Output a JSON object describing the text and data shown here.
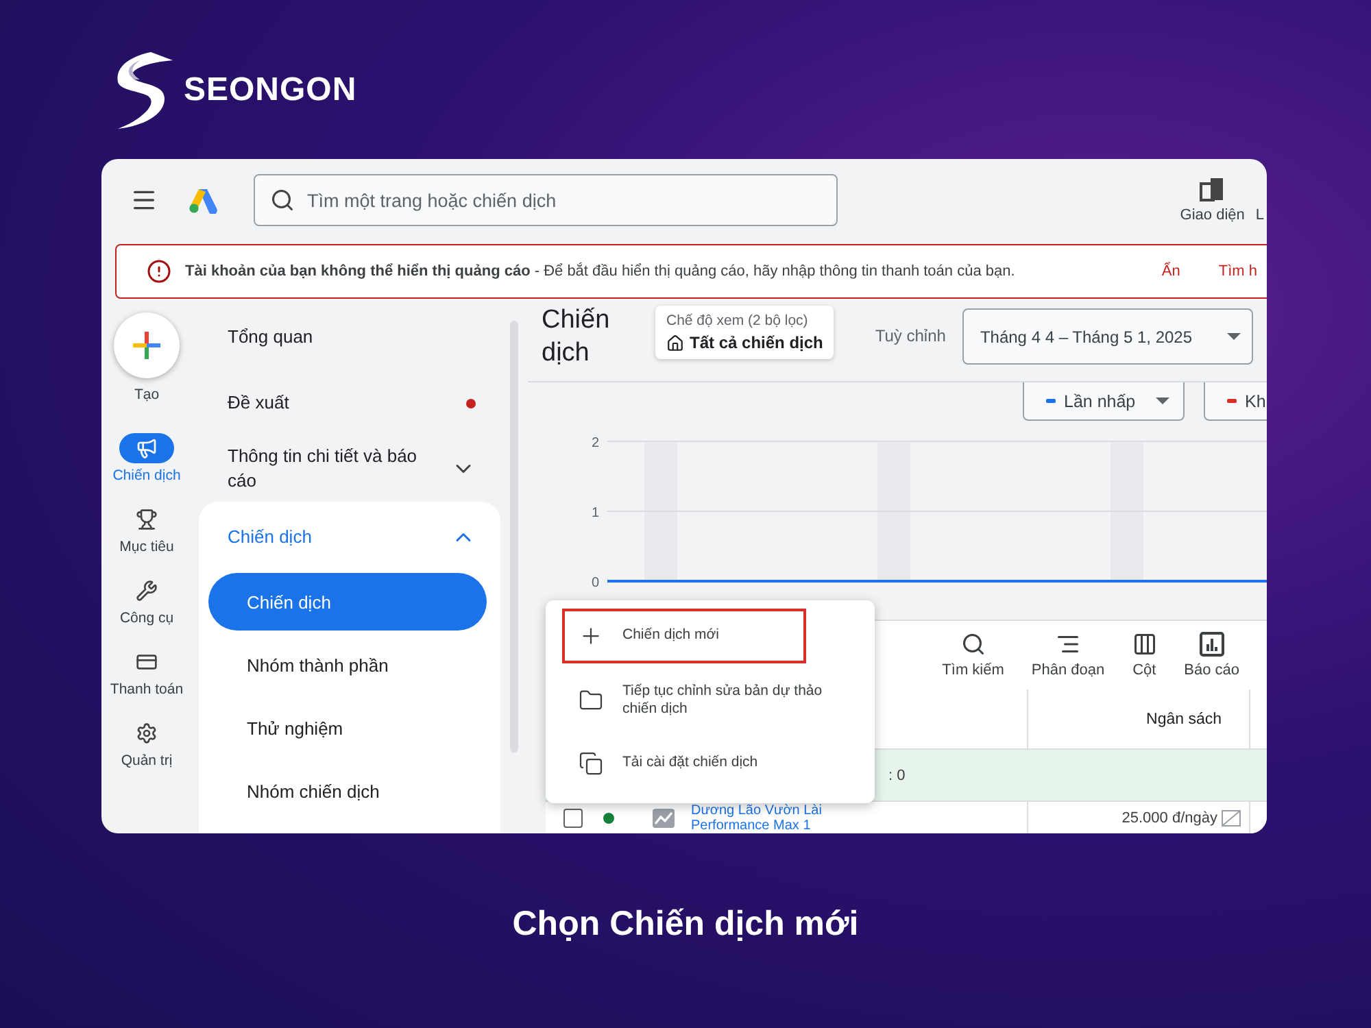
{
  "brand": {
    "name": "SEONGON"
  },
  "top_bar": {
    "search": {
      "placeholder": "Tìm một trang hoặc chiến dịch"
    },
    "actions": [
      {
        "label": "Giao diện",
        "kind": "appearance"
      },
      {
        "label": "L",
        "kind": "cut"
      }
    ]
  },
  "alert": {
    "text": "**Tài khoản của bạn không thể hiển thị quảng cáo** - Để bắt đầu hiển thị quảng cáo, hãy nhập thông tin thanh toán của bạn.",
    "actions": [
      "Ẩn",
      "Tìm h"
    ]
  },
  "rail": {
    "create": {
      "label": "Tạo"
    },
    "items": [
      {
        "label": "Chiến dịch",
        "kind": "campaign",
        "selected": true
      },
      {
        "label": "Mục tiêu",
        "kind": "goal",
        "selected": false
      },
      {
        "label": "Công cụ",
        "kind": "tools",
        "selected": false
      },
      {
        "label": "Thanh toán",
        "kind": "billing",
        "selected": false
      },
      {
        "label": "Quản trị",
        "kind": "admin",
        "selected": false
      }
    ]
  },
  "nav": {
    "items": [
      {
        "label": "Tổng quan",
        "dot": false
      },
      {
        "label": "Đề xuất",
        "dot": true
      },
      {
        "label": "Thông tin chi tiết và báo cáo",
        "dot": false,
        "expanded": false
      },
      {
        "label": "Chiến dịch",
        "expanded": true,
        "children": [
          {
            "label": "Chiến dịch",
            "selected": true
          },
          {
            "label": "Nhóm thành phần",
            "selected": false
          },
          {
            "label": "Thử nghiệm",
            "selected": false
          },
          {
            "label": "Nhóm chiến dịch",
            "selected": false
          }
        ]
      }
    ]
  },
  "header": {
    "title": "Chiến dịch",
    "view": {
      "caption": "Chế độ xem (2 bộ lọc)",
      "value": "Tất cả chiến dịch"
    },
    "range_label": "Tuỳ chỉnh",
    "date_range": "Tháng 4 4 – Tháng 5 1, 2025"
  },
  "metrics": [
    {
      "label": "Lần nhấp",
      "color": "#1a73e8"
    },
    {
      "label": "Kh",
      "color": "#d93025"
    }
  ],
  "chart_data": {
    "type": "line",
    "ylim": [
      0,
      2
    ],
    "yticks": [
      0,
      1,
      2
    ],
    "series": [
      {
        "color": "#1a73e8",
        "values": [
          0,
          0,
          0,
          0,
          0,
          0,
          0,
          0
        ]
      }
    ]
  },
  "toolbar": [
    {
      "label": "Tìm kiếm",
      "kind": "search"
    },
    {
      "label": "Phân đoạn",
      "kind": "segment"
    },
    {
      "label": "Cột",
      "kind": "columns"
    },
    {
      "label": "Báo cáo",
      "kind": "report"
    }
  ],
  "table": {
    "columns": [
      "Ngân sách"
    ],
    "summary": ": 0",
    "rows": [
      {
        "checked": false,
        "color": "#188038",
        "name": "Dương Lão Vườn Lài",
        "subname": "Performance Max 1",
        "budget": "25.000 đ/ngày"
      }
    ]
  },
  "create_menu": {
    "items": [
      {
        "label": "Chiến dịch mới",
        "kind": "new",
        "highlighted": true
      },
      {
        "label": "Tiếp tục chỉnh sửa bản dự thảo chiến dịch",
        "kind": "draft",
        "highlighted": false
      },
      {
        "label": "Tải cài đặt chiến dịch",
        "kind": "copy",
        "highlighted": false
      }
    ]
  },
  "caption": "Chọn Chiến dịch mới"
}
